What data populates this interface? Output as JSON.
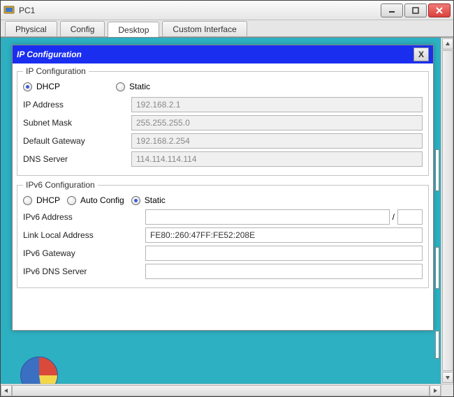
{
  "window": {
    "title": "PC1"
  },
  "tabs": [
    {
      "label": "Physical",
      "active": false
    },
    {
      "label": "Config",
      "active": false
    },
    {
      "label": "Desktop",
      "active": true
    },
    {
      "label": "Custom Interface",
      "active": false
    }
  ],
  "dialog": {
    "title": "IP Configuration",
    "close_label": "X",
    "ipv4": {
      "legend": "IP Configuration",
      "mode_dhcp": "DHCP",
      "mode_static": "Static",
      "selected": "dhcp",
      "ip_label": "IP Address",
      "ip_value": "192.168.2.1",
      "mask_label": "Subnet Mask",
      "mask_value": "255.255.255.0",
      "gw_label": "Default Gateway",
      "gw_value": "192.168.2.254",
      "dns_label": "DNS Server",
      "dns_value": "114.114.114.114"
    },
    "ipv6": {
      "legend": "IPv6 Configuration",
      "mode_dhcp": "DHCP",
      "mode_auto": "Auto Config",
      "mode_static": "Static",
      "selected": "static",
      "addr_label": "IPv6 Address",
      "addr_value": "",
      "prefix_value": "",
      "lla_label": "Link Local Address",
      "lla_value": "FE80::260:47FF:FE52:208E",
      "gw_label": "IPv6 Gateway",
      "gw_value": "",
      "dns_label": "IPv6 DNS Server",
      "dns_value": ""
    }
  }
}
